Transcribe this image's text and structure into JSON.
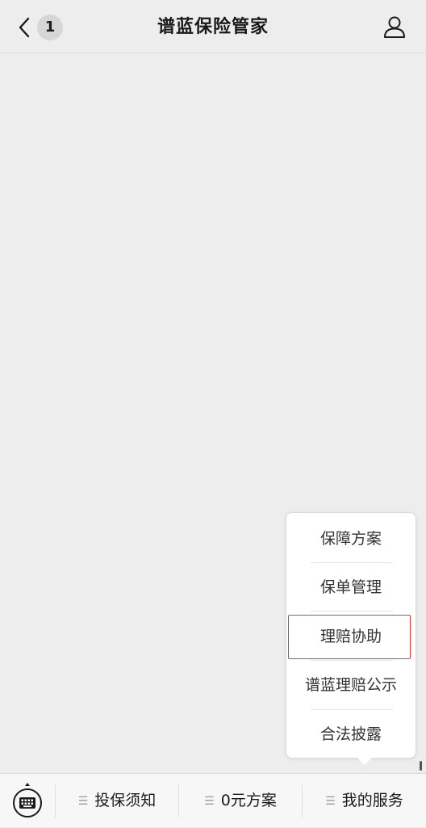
{
  "nav": {
    "unread_count": "1",
    "title": "谱蓝保险管家",
    "back_icon": "chevron-left-icon",
    "profile_icon": "person-icon"
  },
  "popup_menu": {
    "items": [
      {
        "label": "保障方案"
      },
      {
        "label": "保单管理"
      },
      {
        "label": "理赔协助",
        "highlighted": true
      },
      {
        "label": "谱蓝理赔公示"
      },
      {
        "label": "合法披露"
      }
    ]
  },
  "bottom_bar": {
    "keyboard_icon": "keyboard-icon",
    "menu_icon": "menu-lines-icon",
    "tabs": [
      {
        "label": "投保须知"
      },
      {
        "label": "0元方案"
      },
      {
        "label": "我的服务"
      }
    ]
  },
  "colors": {
    "background": "#ededed",
    "highlight_border": "#d9423a"
  }
}
